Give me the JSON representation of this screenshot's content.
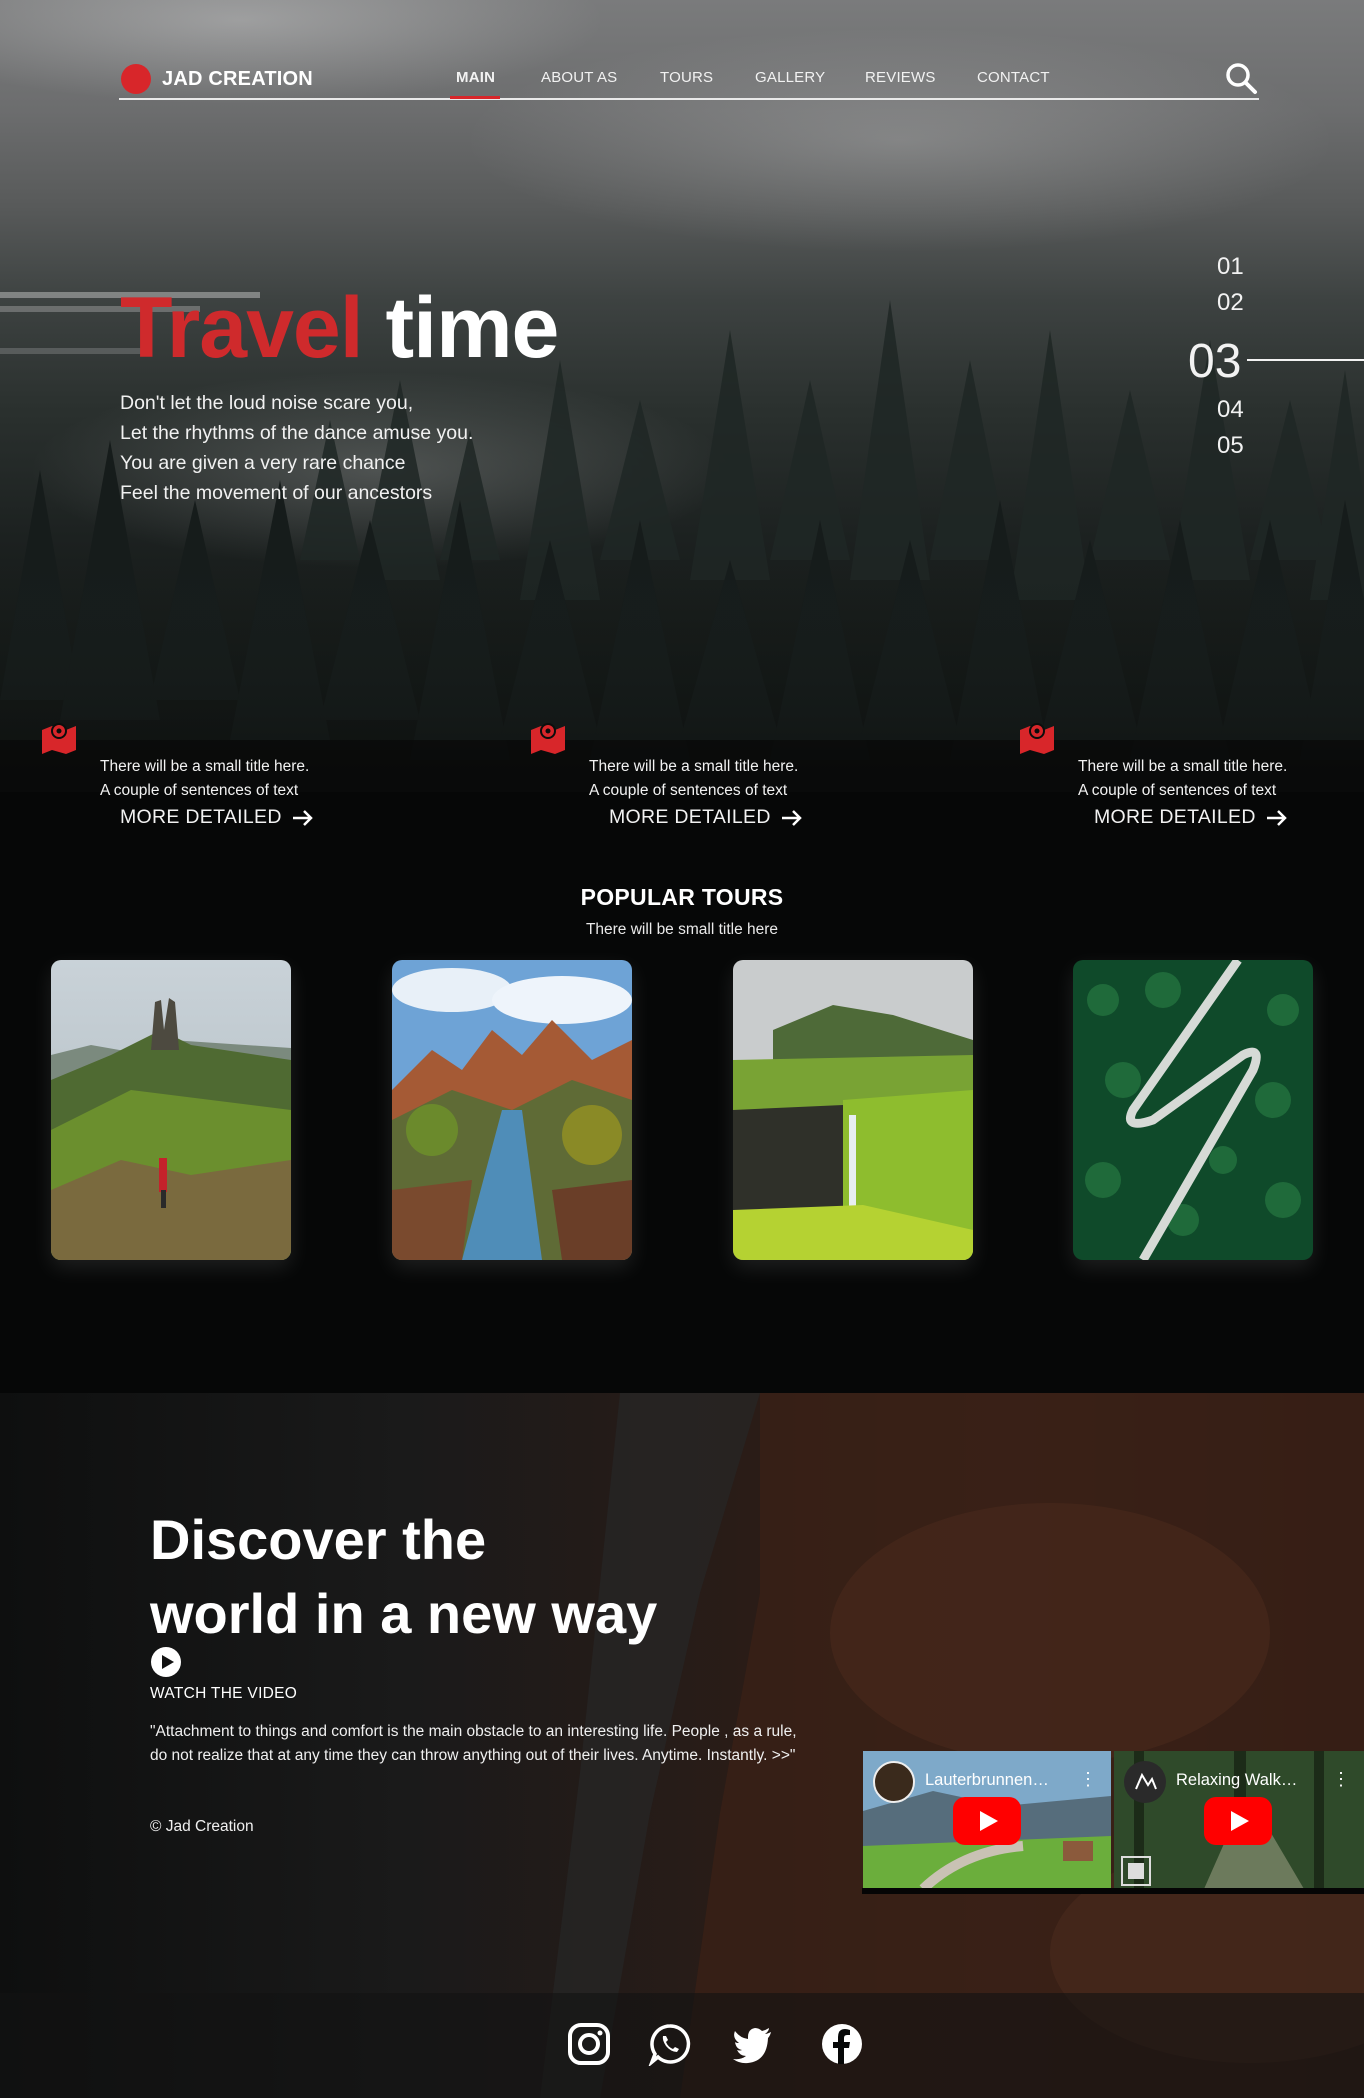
{
  "brand": {
    "name": "JAD CREATION",
    "accent": "#d8262a"
  },
  "nav": {
    "items": [
      {
        "label": "MAIN",
        "active": true
      },
      {
        "label": "ABOUT AS"
      },
      {
        "label": "TOURS"
      },
      {
        "label": "GALLERY"
      },
      {
        "label": "REVIEWS"
      },
      {
        "label": "CONTACT"
      }
    ],
    "search_icon": "search-icon"
  },
  "hero": {
    "title_part1": "Travel",
    "title_part2": "time",
    "lines": [
      "Don't let the loud noise scare you,",
      "Let the rhythms of the dance amuse you.",
      "You are given a very rare chance",
      "Feel the movement of our ancestors"
    ],
    "slides": [
      "01",
      "02",
      "03",
      "04",
      "05"
    ],
    "active_slide": "03"
  },
  "features": [
    {
      "title": "There will be a small title here.",
      "text": "A couple of sentences of text",
      "link": "MORE DETAILED"
    },
    {
      "title": "There will be a small title here.",
      "text": "A couple of sentences of text",
      "link": "MORE DETAILED"
    },
    {
      "title": "There will be a small title here.",
      "text": "A couple of sentences of text",
      "link": "MORE DETAILED"
    }
  ],
  "tours": {
    "title": "POPULAR TOURS",
    "subtitle": "There will be small title here"
  },
  "discover": {
    "title_line1": "Discover the",
    "title_line2": "world in a new way",
    "watch_label": "WATCH THE VIDEO",
    "quote": "\"Attachment to things and comfort is the main obstacle to an interesting life. People , as a rule, do not realize that at any time they can throw anything out of their lives. Anytime. Instantly. >>\"",
    "copyright": "© Jad Creation"
  },
  "videos": [
    {
      "title": "Lauterbrunnen…"
    },
    {
      "title": "Relaxing Walk…"
    }
  ],
  "social": [
    "instagram-icon",
    "whatsapp-icon",
    "twitter-icon",
    "facebook-icon"
  ]
}
